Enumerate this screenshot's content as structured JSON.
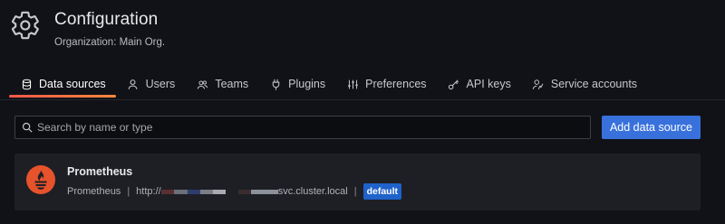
{
  "header": {
    "title": "Configuration",
    "subtitle": "Organization: Main Org.",
    "icon": "gear-icon"
  },
  "tabs": [
    {
      "label": "Data sources",
      "icon": "database-icon",
      "active": true
    },
    {
      "label": "Users",
      "icon": "user-icon",
      "active": false
    },
    {
      "label": "Teams",
      "icon": "users-icon",
      "active": false
    },
    {
      "label": "Plugins",
      "icon": "plug-icon",
      "active": false
    },
    {
      "label": "Preferences",
      "icon": "sliders-icon",
      "active": false
    },
    {
      "label": "API keys",
      "icon": "key-icon",
      "active": false
    },
    {
      "label": "Service accounts",
      "icon": "user-cog-icon",
      "active": false
    }
  ],
  "search": {
    "placeholder": "Search by name or type",
    "value": ""
  },
  "add_button": {
    "label": "Add data source"
  },
  "datasources": [
    {
      "name": "Prometheus",
      "type": "Prometheus",
      "url_prefix": "http://",
      "url_suffix": "svc.cluster.local",
      "badge": "default",
      "separator": "|"
    }
  ],
  "colors": {
    "background": "#111217",
    "card": "#1e1f24",
    "primary_button": "#3871dc",
    "badge": "#1f62c9",
    "active_tab_underline": "#f7574a",
    "prometheus_logo": "#e6522c"
  }
}
